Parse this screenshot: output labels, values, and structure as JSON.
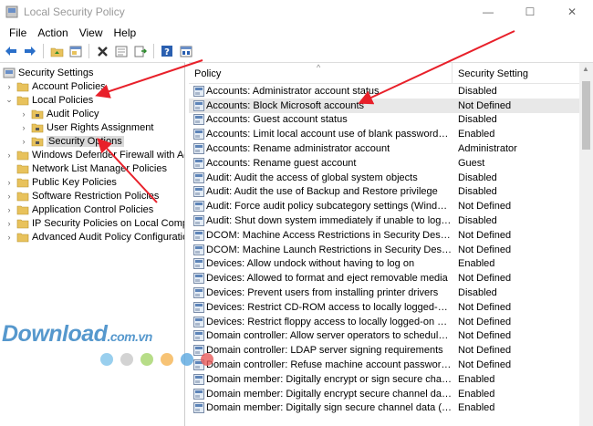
{
  "window": {
    "title": "Local Security Policy",
    "minimize": "—",
    "maximize": "☐",
    "close": "✕"
  },
  "menu": [
    "File",
    "Action",
    "View",
    "Help"
  ],
  "toolbar": [
    "back-icon",
    "forward-icon",
    "up-folder-icon",
    "properties-view-icon",
    "delete-icon",
    "refresh-icon",
    "export-icon",
    "help-icon",
    "console-icon"
  ],
  "tree": {
    "root": "Security Settings",
    "items": [
      {
        "label": "Account Policies",
        "level": 1,
        "toggle": "collapsed"
      },
      {
        "label": "Local Policies",
        "level": 1,
        "toggle": "expanded"
      },
      {
        "label": "Audit Policy",
        "level": 2,
        "toggle": "collapsed"
      },
      {
        "label": "User Rights Assignment",
        "level": 2,
        "toggle": "collapsed"
      },
      {
        "label": "Security Options",
        "level": 2,
        "toggle": "collapsed",
        "selected": true
      },
      {
        "label": "Windows Defender Firewall with Adva",
        "level": 1,
        "toggle": "collapsed"
      },
      {
        "label": "Network List Manager Policies",
        "level": 1,
        "toggle": "none"
      },
      {
        "label": "Public Key Policies",
        "level": 1,
        "toggle": "collapsed"
      },
      {
        "label": "Software Restriction Policies",
        "level": 1,
        "toggle": "collapsed"
      },
      {
        "label": "Application Control Policies",
        "level": 1,
        "toggle": "collapsed"
      },
      {
        "label": "IP Security Policies on Local Compute",
        "level": 1,
        "toggle": "collapsed"
      },
      {
        "label": "Advanced Audit Policy Configuration",
        "level": 1,
        "toggle": "collapsed"
      }
    ]
  },
  "columns": {
    "policy": "Policy",
    "setting": "Security Setting",
    "sort": "^"
  },
  "policies": [
    {
      "name": "Accounts: Administrator account status",
      "setting": "Disabled"
    },
    {
      "name": "Accounts: Block Microsoft accounts",
      "setting": "Not Defined"
    },
    {
      "name": "Accounts: Guest account status",
      "setting": "Disabled"
    },
    {
      "name": "Accounts: Limit local account use of blank passwords to co...",
      "setting": "Enabled"
    },
    {
      "name": "Accounts: Rename administrator account",
      "setting": "Administrator"
    },
    {
      "name": "Accounts: Rename guest account",
      "setting": "Guest"
    },
    {
      "name": "Audit: Audit the access of global system objects",
      "setting": "Disabled"
    },
    {
      "name": "Audit: Audit the use of Backup and Restore privilege",
      "setting": "Disabled"
    },
    {
      "name": "Audit: Force audit policy subcategory settings (Windows Vis...",
      "setting": "Not Defined"
    },
    {
      "name": "Audit: Shut down system immediately if unable to log secur...",
      "setting": "Disabled"
    },
    {
      "name": "DCOM: Machine Access Restrictions in Security Descriptor D...",
      "setting": "Not Defined"
    },
    {
      "name": "DCOM: Machine Launch Restrictions in Security Descriptor ...",
      "setting": "Not Defined"
    },
    {
      "name": "Devices: Allow undock without having to log on",
      "setting": "Enabled"
    },
    {
      "name": "Devices: Allowed to format and eject removable media",
      "setting": "Not Defined"
    },
    {
      "name": "Devices: Prevent users from installing printer drivers",
      "setting": "Disabled"
    },
    {
      "name": "Devices: Restrict CD-ROM access to locally logged-on user ...",
      "setting": "Not Defined"
    },
    {
      "name": "Devices: Restrict floppy access to locally logged-on user only",
      "setting": "Not Defined"
    },
    {
      "name": "Domain controller: Allow server operators to schedule tasks",
      "setting": "Not Defined"
    },
    {
      "name": "Domain controller: LDAP server signing requirements",
      "setting": "Not Defined"
    },
    {
      "name": "Domain controller: Refuse machine account password chan",
      "setting": "Not Defined"
    },
    {
      "name": "Domain member: Digitally encrypt or sign secure channel d...",
      "setting": "Enabled"
    },
    {
      "name": "Domain member: Digitally encrypt secure channel data (wh...",
      "setting": "Enabled"
    },
    {
      "name": "Domain member: Digitally sign secure channel data (when ...",
      "setting": "Enabled"
    }
  ],
  "watermark": {
    "main": "Download",
    "suffix": ".com.vn"
  },
  "colors": {
    "arrow": "#e8202a",
    "watermark": "#2d7fc1",
    "folder": "#e8c25c",
    "selected": "#d9d9d9"
  },
  "dots": [
    "#7fc3ea",
    "#c8c8c8",
    "#a5d46a",
    "#f5b452",
    "#5aa8e0",
    "#e85a5a"
  ]
}
